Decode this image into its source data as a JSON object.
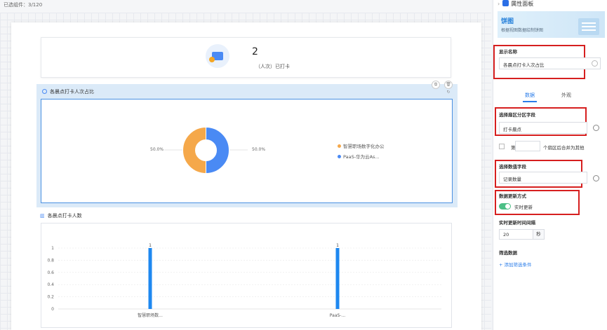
{
  "topbar": {
    "selected_count": "已选组件：3/120"
  },
  "stat_card": {
    "value": "2",
    "unit_label": "（人次）已打卡"
  },
  "pie": {
    "title": "各晨点打卡人次占比",
    "left_pct": "50.0%",
    "right_pct": "50.0%",
    "colors": {
      "a": "#f5a84a",
      "b": "#4a8af4"
    },
    "legend": [
      "智慧职场数字化办公",
      "PaaS-华为云As..."
    ]
  },
  "bar": {
    "title": "各晨点打卡人数"
  },
  "chart_data": [
    {
      "type": "pie",
      "categories": [
        "智慧职场数字化办公",
        "PaaS-华为云As..."
      ],
      "values": [
        50.0,
        50.0
      ],
      "data_labels": [
        "50.0%",
        "50.0%"
      ],
      "title": "各晨点打卡人次占比"
    },
    {
      "type": "bar",
      "categories": [
        "智慧职场数...",
        "PaaS-..."
      ],
      "values": [
        1,
        1
      ],
      "data_labels": [
        "1",
        "1"
      ],
      "yticks": [
        "0",
        "0.2",
        "0.4",
        "0.6",
        "0.8",
        "1"
      ],
      "ylim": [
        0,
        1
      ],
      "title": "各晨点打卡人数",
      "grid": true,
      "color": "#1e88f0"
    }
  ],
  "panel": {
    "title": "属性面板",
    "banner_title": "饼图",
    "banner_desc": "根据视图数据绘制饼图",
    "display_name_label": "显示名称",
    "display_name_value": "各晨点打卡人次占比",
    "tabs": [
      "数据",
      "外观"
    ],
    "sector_field_label": "选择扇区分区字段",
    "sector_field_value": "打卡晨点",
    "merge_prefix": "第",
    "merge_suffix": "个扇区后合并为其他",
    "value_field_label": "选择数值字段",
    "value_field_value": "记录数量",
    "update_mode_label": "数据更新方式",
    "update_mode_value": "实时更新",
    "interval_label": "实时更新时间间隔",
    "interval_value": "20",
    "interval_unit": "秒",
    "filter_label": "筛选数据",
    "add_filter": "+ 添加筛选条件"
  }
}
